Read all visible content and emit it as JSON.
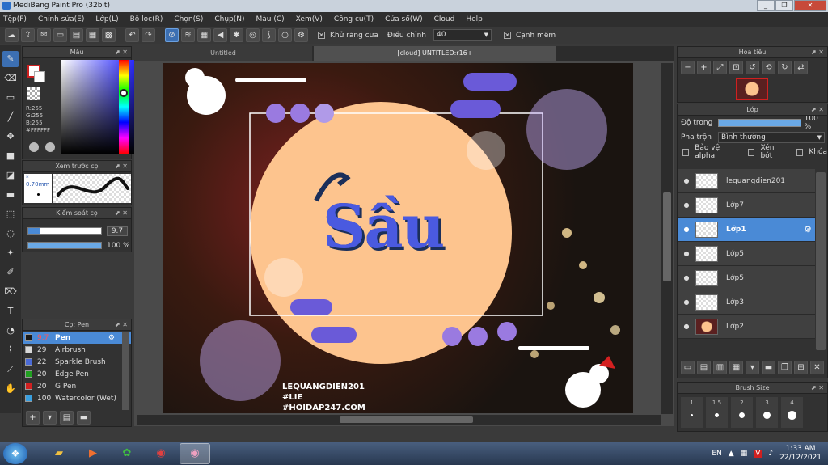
{
  "window": {
    "title": "MediBang Paint Pro (32bit)",
    "minimize": "_",
    "restore": "❐",
    "close": "✕"
  },
  "menu": [
    "Tệp(F)",
    "Chỉnh sửa(E)",
    "Lớp(L)",
    "Bộ lọc(R)",
    "Chọn(S)",
    "Chụp(N)",
    "Màu (C)",
    "Xem(V)",
    "Công cụ(T)",
    "Cửa sổ(W)",
    "Cloud",
    "Help"
  ],
  "toolbar": {
    "antialias_label": "Khử răng cưa",
    "adjust_label": "Điều chỉnh",
    "adjust_value": "40",
    "sharp_edge_label": "Cạnh mềm"
  },
  "color_panel": {
    "title": "Màu",
    "r": "R:255",
    "g": "G:255",
    "b": "B:255",
    "hex": "#FFFFFF",
    "primary_color": "#ffffff",
    "secondary_color": "#cc2020"
  },
  "brush_preview": {
    "title": "Xem trước cọ",
    "size": "0.70mm"
  },
  "brush_control": {
    "title": "Kiểm soát cọ",
    "size_value": "9.7",
    "opacity_value": "100 %",
    "size_fraction": 0.9,
    "opacity_fraction": 1.0
  },
  "brush_list": {
    "title": "Cọ: Pen",
    "items": [
      {
        "size": "9.7",
        "name": "Pen",
        "color": "#1a1a1a",
        "selected": true
      },
      {
        "size": "29",
        "name": "Airbrush",
        "color": "#d8d8d8",
        "selected": false
      },
      {
        "size": "22",
        "name": "Sparkle Brush",
        "color": "#4a6ad6",
        "selected": false
      },
      {
        "size": "20",
        "name": "Edge Pen",
        "color": "#20a020",
        "selected": false
      },
      {
        "size": "20",
        "name": "G Pen",
        "color": "#d02020",
        "selected": false
      },
      {
        "size": "100",
        "name": "Watercolor (Wet)",
        "color": "#3aa0e0",
        "selected": false
      }
    ]
  },
  "tabs": [
    {
      "label": "Untitled",
      "active": false
    },
    {
      "label": "[cloud] UNTITLED:r16+",
      "active": true
    }
  ],
  "artwork": {
    "title_text": "Sầu",
    "watermark_lines": [
      "LEQUANGDIEN201",
      "#LIE",
      "#HOIDAP247.COM"
    ],
    "circle_color": "#fdc48e"
  },
  "navigator": {
    "title": "Hoa tiêu"
  },
  "layers": {
    "title": "Lớp",
    "opacity_label": "Độ trong",
    "opacity_value": "100 %",
    "opacity_fraction": 1.0,
    "blend_label": "Pha trộn",
    "blend_value": "Bình thường",
    "protect_alpha_label": "Bảo vệ alpha",
    "clipping_label": "Xén bớt",
    "lock_label": "Khóa",
    "items": [
      {
        "name": "lequangdien201",
        "selected": false
      },
      {
        "name": "Lớp7",
        "selected": false
      },
      {
        "name": "Lớp1",
        "selected": true
      },
      {
        "name": "Lớp5",
        "selected": false
      },
      {
        "name": "Lớp5",
        "selected": false
      },
      {
        "name": "Lớp3",
        "selected": false
      },
      {
        "name": "Lớp2",
        "selected": false
      }
    ]
  },
  "brush_size_panel": {
    "title": "Brush Size",
    "sizes": [
      "1",
      "1.5",
      "2",
      "3",
      "4"
    ]
  },
  "taskbar": {
    "language": "EN",
    "time": "1:33 AM",
    "date": "22/12/2021"
  }
}
